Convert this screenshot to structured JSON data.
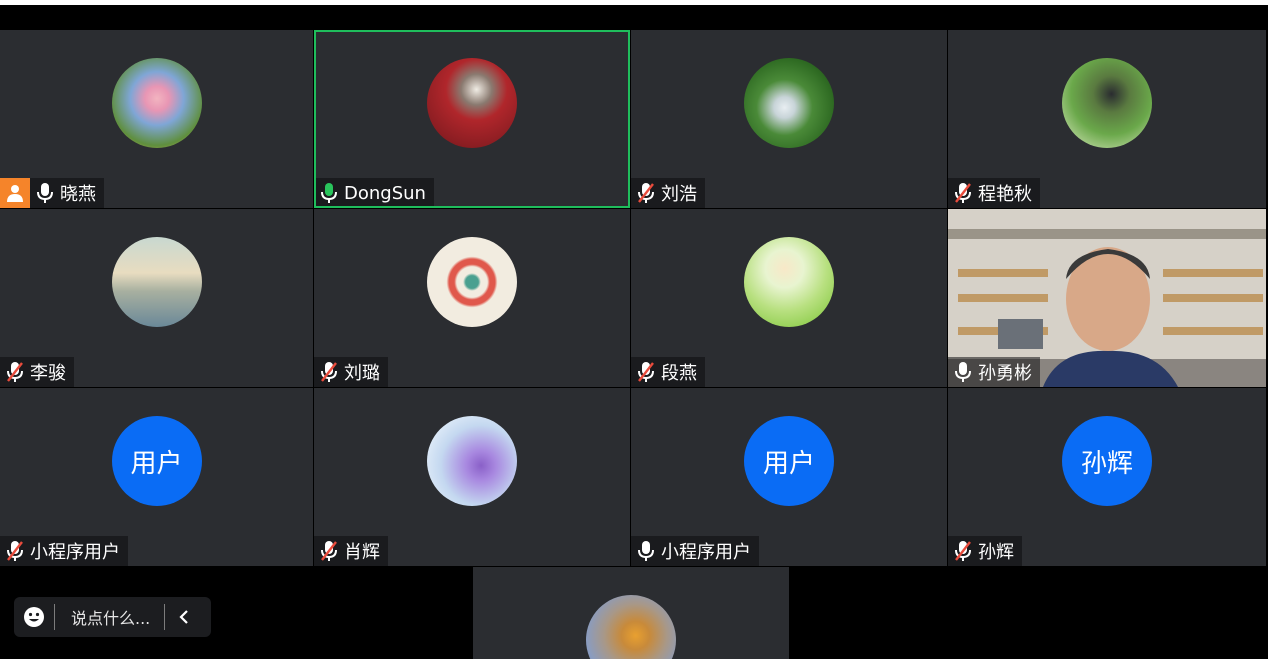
{
  "participants": [
    {
      "name": "晓燕",
      "mic": "on",
      "host": true,
      "avatar": "sky-photo"
    },
    {
      "name": "DongSun",
      "mic": "speaking",
      "active": true,
      "avatar": "cat-photo"
    },
    {
      "name": "刘浩",
      "mic": "muted",
      "avatar": "waterfall-photo"
    },
    {
      "name": "程艳秋",
      "mic": "muted",
      "avatar": "garden-photo"
    },
    {
      "name": "李骏",
      "mic": "muted",
      "avatar": "lake-painting"
    },
    {
      "name": "刘璐",
      "mic": "muted",
      "avatar": "wreath-art"
    },
    {
      "name": "段燕",
      "mic": "muted",
      "avatar": "cartoon-girl"
    },
    {
      "name": "孙勇彬",
      "mic": "on",
      "avatar": "live-video"
    },
    {
      "name": "小程序用户",
      "mic": "muted",
      "avatar_text": "用户"
    },
    {
      "name": "肖辉",
      "mic": "muted",
      "avatar": "flower-photo"
    },
    {
      "name": "小程序用户",
      "mic": "on",
      "avatar_text": "用户"
    },
    {
      "name": "孙辉",
      "mic": "muted",
      "avatar_text": "孙辉"
    },
    {
      "name": "",
      "mic": "",
      "avatar": "bird-painting"
    }
  ],
  "chat": {
    "placeholder": "说点什么..."
  },
  "colors": {
    "tile": "#2b2d31",
    "active_border": "#1fbd5c",
    "text_avatar": "#0a6cf5",
    "host_badge": "#f5842a",
    "muted_red": "#e84b3c",
    "speaking_green": "#29c45c"
  }
}
